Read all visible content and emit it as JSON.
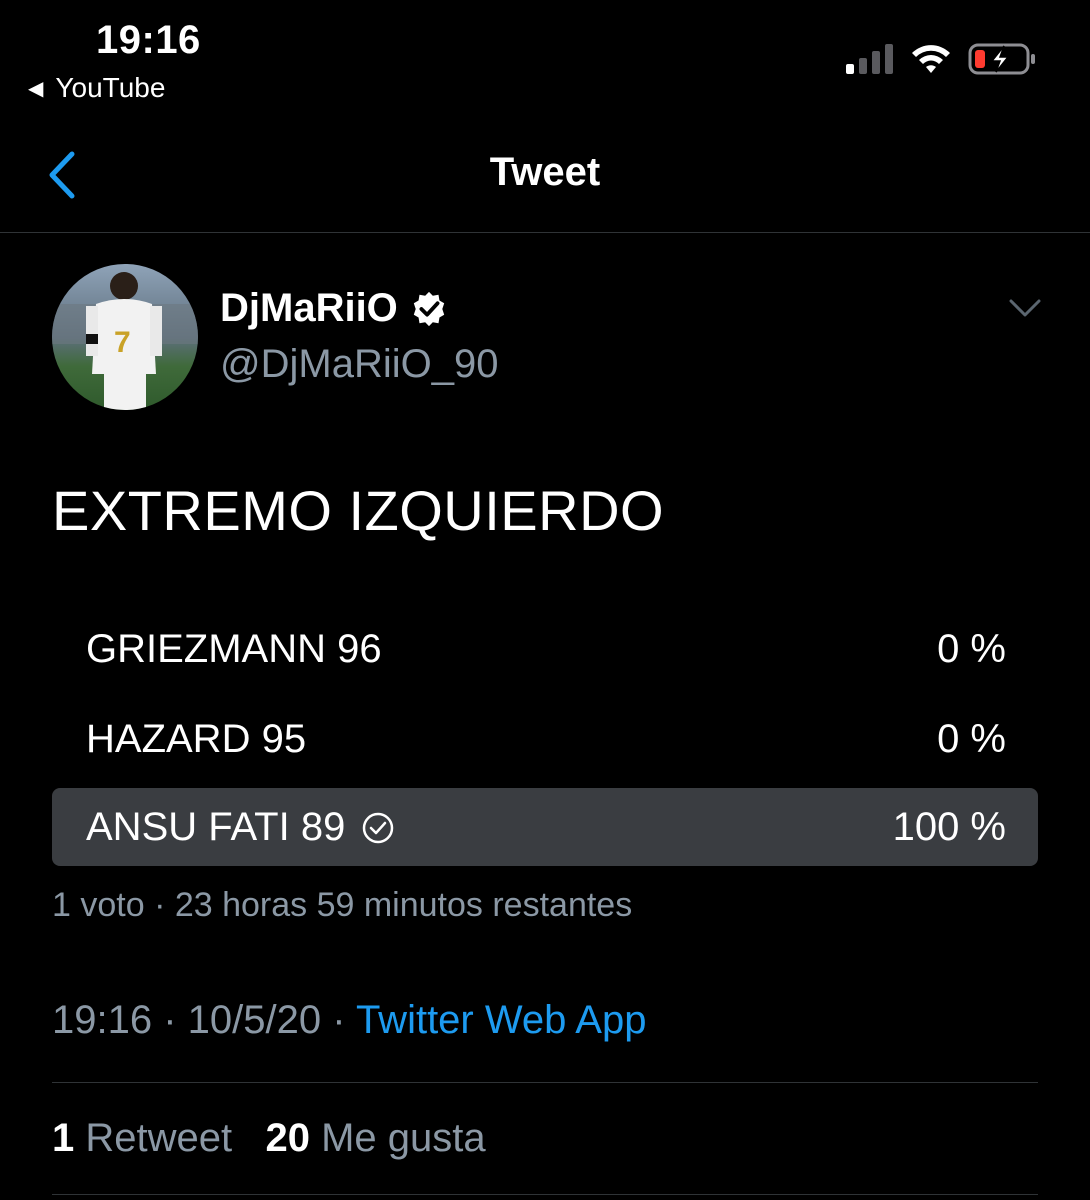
{
  "status_bar": {
    "time": "19:16",
    "back_app": "YouTube",
    "icons": [
      "signal-icon",
      "wifi-icon",
      "battery-charging-icon"
    ],
    "battery_color": "#ff3b30"
  },
  "nav": {
    "title": "Tweet",
    "back_icon": "chevron-left-icon",
    "accent": "#1d9bf0"
  },
  "author": {
    "display_name": "DjMaRiiO",
    "handle": "@DjMaRiiO_90",
    "verified": true
  },
  "tweet": {
    "text": "EXTREMO IZQUIERDO"
  },
  "poll": {
    "options": [
      {
        "label": "GRIEZMANN 96",
        "percent": "0 %",
        "winner": false
      },
      {
        "label": "HAZARD 95",
        "percent": "0 %",
        "winner": false
      },
      {
        "label": "ANSU FATI 89",
        "percent": "100 %",
        "winner": true
      }
    ],
    "meta": "1 voto · 23 horas 59 minutos restantes"
  },
  "timestamp": {
    "time": "19:16",
    "date": "10/5/20",
    "sep": " · ",
    "source": "Twitter Web App"
  },
  "stats": {
    "retweets_count": "1",
    "retweets_label": "Retweet",
    "likes_count": "20",
    "likes_label": "Me gusta"
  }
}
